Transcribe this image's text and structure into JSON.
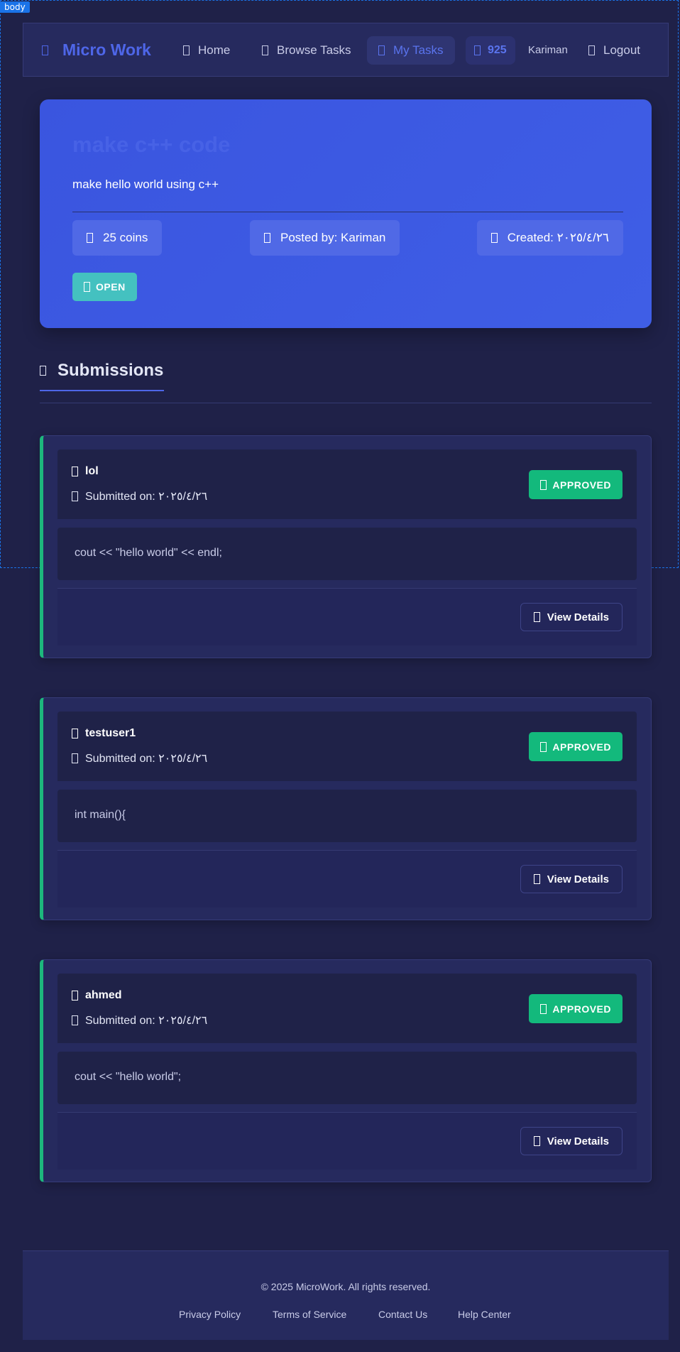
{
  "devtools": {
    "tag": "body"
  },
  "nav": {
    "brand": "Micro Work",
    "links": [
      {
        "label": "Home"
      },
      {
        "label": "Browse Tasks"
      },
      {
        "label": "My Tasks",
        "active": true
      }
    ],
    "coins": "925",
    "user": "Kariman",
    "logout": "Logout"
  },
  "task": {
    "title": "make c++ code",
    "description": "make hello world using c++",
    "reward": "25 coins",
    "posted_by": "Posted by: Kariman",
    "created": "Created: ٢٠٢٥/٤/٢٦",
    "status": "OPEN"
  },
  "submissions_heading": "Submissions",
  "submissions": [
    {
      "user": "lol",
      "date": "Submitted on: ٢٠٢٥/٤/٢٦",
      "status": "APPROVED",
      "content": "cout << \"hello world\" << endl;",
      "action": "View Details"
    },
    {
      "user": "testuser1",
      "date": "Submitted on: ٢٠٢٥/٤/٢٦",
      "status": "APPROVED",
      "content": "int main(){",
      "action": "View Details"
    },
    {
      "user": "ahmed",
      "date": "Submitted on: ٢٠٢٥/٤/٢٦",
      "status": "APPROVED",
      "content": "cout << \"hello world\";",
      "action": "View Details"
    }
  ],
  "footer": {
    "copyright": "© 2025 MicroWork. All rights reserved.",
    "links": [
      "Privacy Policy",
      "Terms of Service",
      "Contact Us",
      "Help Center"
    ]
  },
  "colors": {
    "background": "#1f2148",
    "accent": "#4e66e8",
    "approved": "#13b97c",
    "open": "#44c1c0"
  }
}
